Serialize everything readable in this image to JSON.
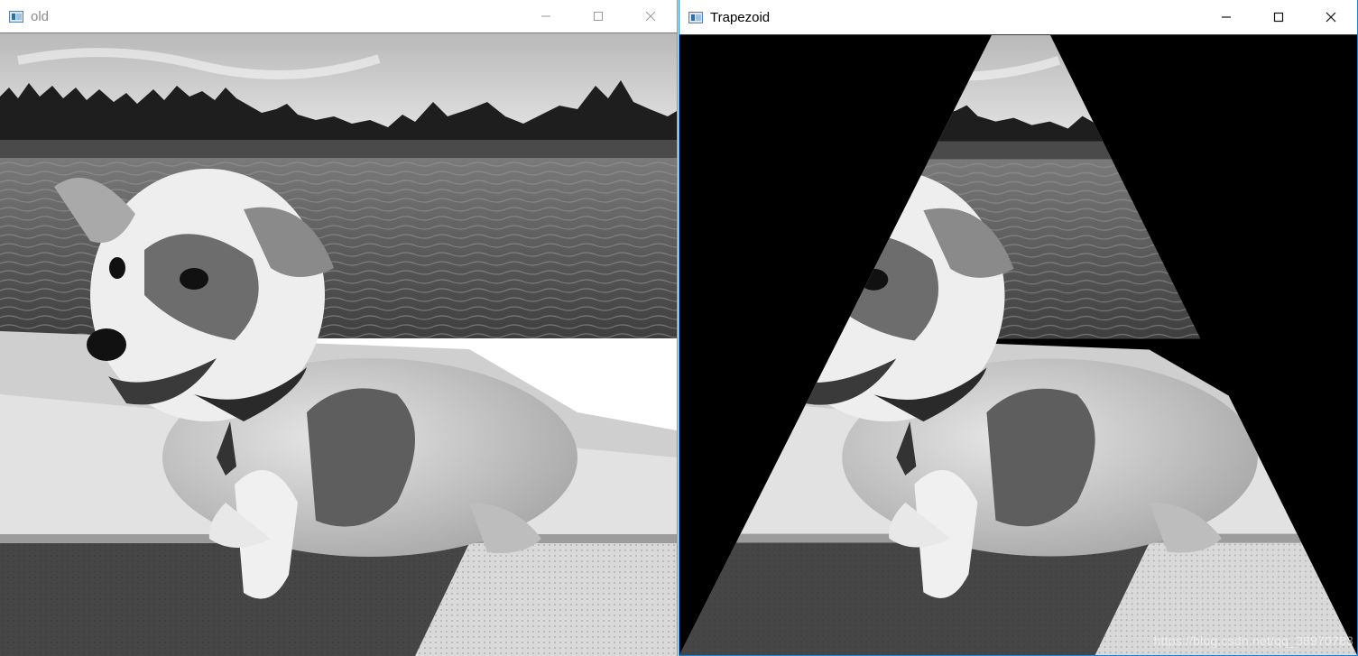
{
  "windows": {
    "left": {
      "title": "old",
      "icon": "window-app-icon"
    },
    "right": {
      "title": "Trapezoid",
      "icon": "window-app-icon"
    }
  },
  "watermark": "https://blog.csdn.net/qq_38970783",
  "colors": {
    "active_border": "#1883d7",
    "inactive_title": "#8c8c8c",
    "background": "#000000"
  }
}
